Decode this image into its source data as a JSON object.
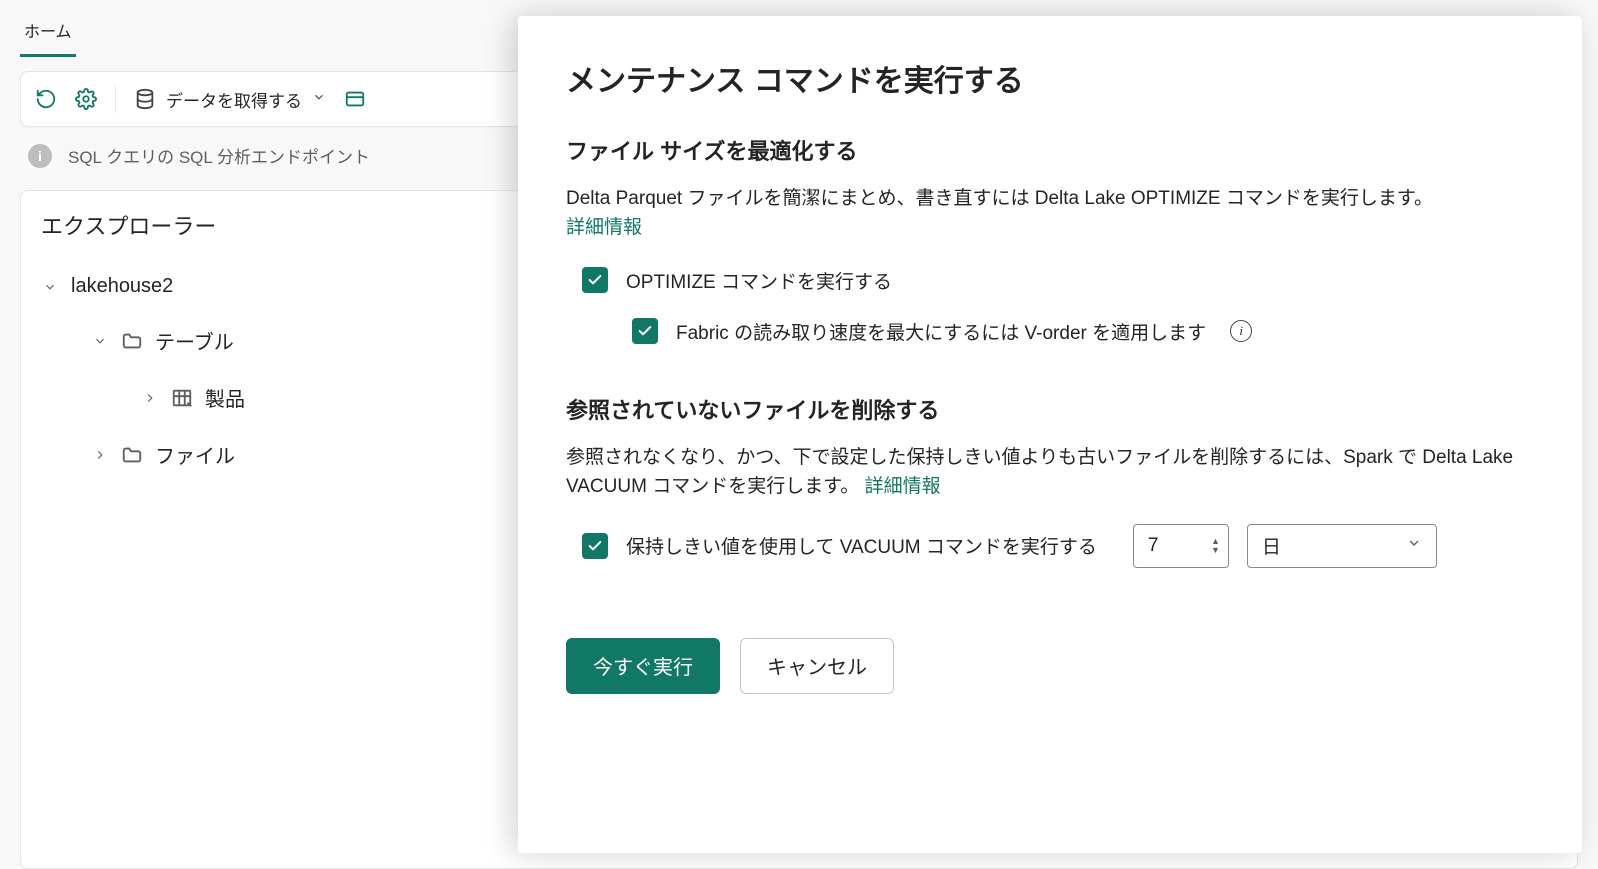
{
  "header": {
    "home_tab": "ホーム"
  },
  "toolbar": {
    "get_data": "データを取得する"
  },
  "info_bar": {
    "text": "SQL クエリの SQL 分析エンドポイント"
  },
  "explorer": {
    "title": "エクスプローラー",
    "root": "lakehouse2",
    "tables": "テーブル",
    "table_item": "製品",
    "files": "ファイル"
  },
  "panel": {
    "title": "メンテナンス コマンドを実行する",
    "optimize": {
      "heading": "ファイル サイズを最適化する",
      "body": "Delta Parquet ファイルを簡潔にまとめ、書き直すには Delta Lake OPTIMIZE コマンドを実行します。",
      "learn_more": "詳細情報",
      "run_optimize": "OPTIMIZE コマンドを実行する",
      "vorder": "Fabric の読み取り速度を最大にするには V-order を適用します"
    },
    "vacuum": {
      "heading": "参照されていないファイルを削除する",
      "body": "参照されなくなり、かつ、下で設定した保持しきい値よりも古いファイルを削除するには、Spark で Delta Lake VACUUM コマンドを実行します。",
      "learn_more": "詳細情報",
      "run_vacuum": "保持しきい値を使用して VACUUM コマンドを実行する",
      "threshold_value": "7",
      "threshold_unit": "日"
    },
    "actions": {
      "run_now": "今すぐ実行",
      "cancel": "キャンセル"
    }
  }
}
